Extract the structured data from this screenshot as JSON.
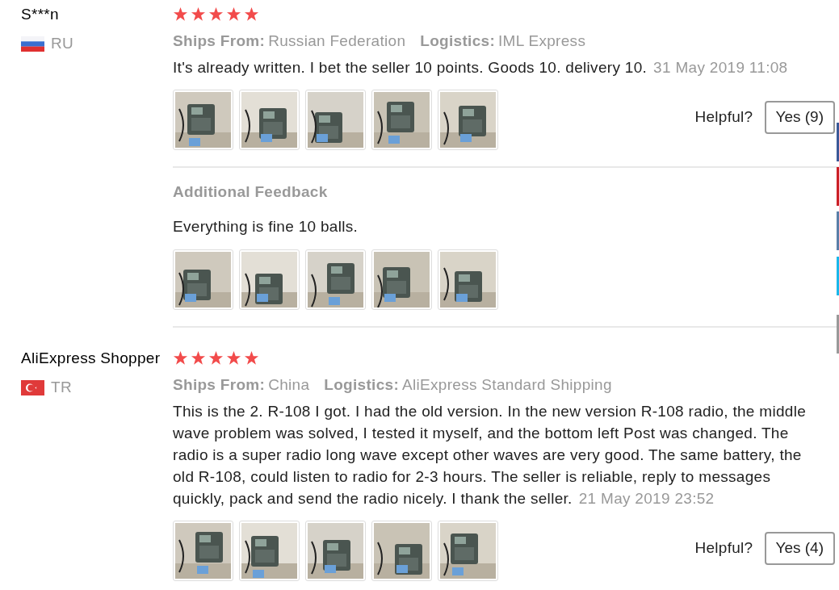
{
  "reviews": [
    {
      "user": "S***n",
      "stars": 5,
      "country": "RU",
      "flag": {
        "kind": "ru"
      },
      "ships_from_label": "Ships From:",
      "ships_from": "Russian Federation",
      "logistics_label": "Logistics:",
      "logistics": "IML Express",
      "text": "It's already written. I bet the seller 10 points. Goods 10. delivery 10.",
      "date": "31 May 2019 11:08",
      "photos": [
        {
          "kind": "picture"
        },
        {
          "kind": "picture"
        },
        {
          "kind": "picture"
        },
        {
          "kind": "picture"
        },
        {
          "kind": "picture"
        }
      ],
      "helpful_label": "Helpful?",
      "helpful_button": "Yes (9)",
      "additional_feedback": {
        "title": "Additional Feedback",
        "text": "Everything is fine 10 balls.",
        "photos": [
          {
            "kind": "picture"
          },
          {
            "kind": "picture"
          },
          {
            "kind": "picture"
          },
          {
            "kind": "picture"
          },
          {
            "kind": "picture"
          }
        ]
      }
    },
    {
      "user": "AliExpress Shopper",
      "stars": 5,
      "country": "TR",
      "flag": {
        "kind": "tr"
      },
      "ships_from_label": "Ships From:",
      "ships_from": "China",
      "logistics_label": "Logistics:",
      "logistics": "AliExpress Standard Shipping",
      "text": "This is the 2. R-108 I got. I had the old version. In the new version R-108 radio, the middle wave problem was solved, I tested it myself, and the bottom left Post was changed. The radio is a super radio long wave except other waves are very good. The same battery, the old R-108, could listen to radio for 2-3 hours. The seller is reliable, reply to messages quickly, pack and send the radio nicely. I thank the seller.",
      "date": "21 May 2019 23:52",
      "photos": [
        {
          "kind": "picture"
        },
        {
          "kind": "picture"
        },
        {
          "kind": "picture"
        },
        {
          "kind": "picture"
        },
        {
          "kind": "picture"
        }
      ],
      "helpful_label": "Helpful?",
      "helpful_button": "Yes (4)"
    }
  ],
  "side_buttons": [
    {
      "color": "#3b5998"
    },
    {
      "color": "#cb2027"
    },
    {
      "color": "#5a7fa8"
    },
    {
      "color": "#1ab7ea"
    },
    {
      "color": "#999999"
    }
  ]
}
